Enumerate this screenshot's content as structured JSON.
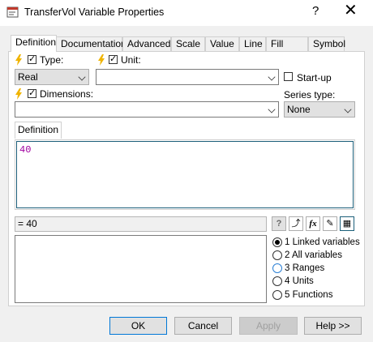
{
  "window": {
    "title": "TransferVol Variable Properties",
    "help_glyph": "?",
    "close_glyph": "✕"
  },
  "tabs": [
    "Definition",
    "Documentation",
    "Advanced",
    "Scale",
    "Value",
    "Line",
    "Fill",
    "Symbol"
  ],
  "type": {
    "label": "Type:",
    "value": "Real"
  },
  "unit": {
    "label": "Unit:",
    "value": ""
  },
  "startup": {
    "label": "Start-up"
  },
  "dimensions": {
    "label": "Dimensions:",
    "value": ""
  },
  "series_type": {
    "label": "Series type:",
    "value": "None"
  },
  "definition": {
    "tab_label": "Definition",
    "text": "40"
  },
  "result": {
    "text": "= 40"
  },
  "toolbar": {
    "help": "?",
    "graph": "⤴",
    "fx": "fx",
    "pencil": "✎",
    "grid": "▦"
  },
  "variables": {
    "options": [
      "1 Linked variables",
      "2 All variables",
      "3 Ranges",
      "4 Units",
      "5 Functions"
    ]
  },
  "buttons": {
    "ok": "OK",
    "cancel": "Cancel",
    "apply": "Apply",
    "help": "Help >>"
  }
}
